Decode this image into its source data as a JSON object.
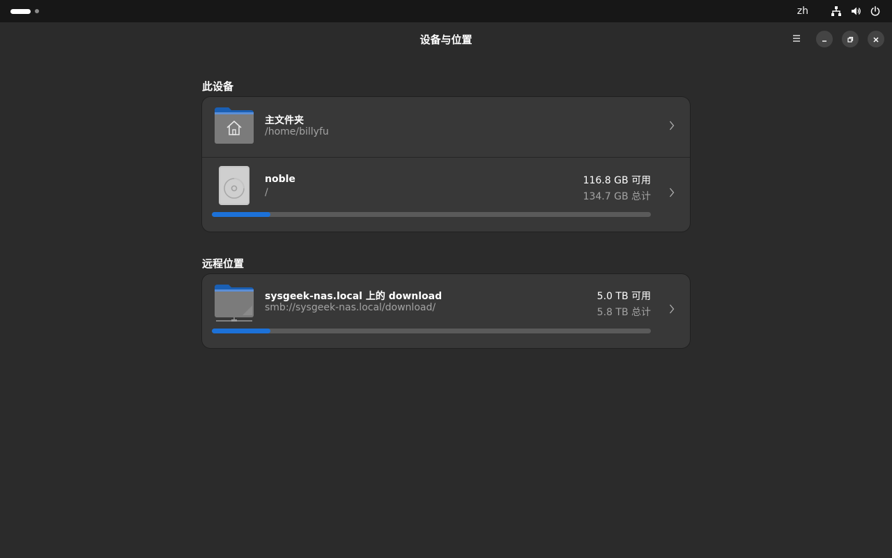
{
  "topbar": {
    "language": "zh",
    "icons": [
      "network-icon",
      "volume-icon",
      "power-icon"
    ]
  },
  "window": {
    "title": "设备与位置",
    "buttons": [
      "menu-icon",
      "minimize-icon",
      "restore-icon",
      "close-icon"
    ]
  },
  "sections": {
    "this_device": {
      "title": "此设备",
      "home": {
        "name": "主文件夹",
        "path": "/home/billyfu",
        "icon": "home-folder-icon"
      },
      "noble": {
        "name": "noble",
        "path": "/",
        "free": "116.8 GB 可用",
        "total": "134.7 GB 总计",
        "used_fraction": 0.133,
        "icon": "drive-icon"
      }
    },
    "remote": {
      "title": "远程位置",
      "nas": {
        "name": "sysgeek-nas.local 上的 download",
        "path": "smb://sysgeek-nas.local/download/",
        "free": "5.0 TB 可用",
        "total": "5.8 TB 总计",
        "used_fraction": 0.134,
        "icon": "network-folder-icon"
      }
    }
  },
  "colors": {
    "accent": "#1c71d8",
    "background": "#2b2b2b",
    "card": "#383838",
    "topbar": "#171717"
  }
}
